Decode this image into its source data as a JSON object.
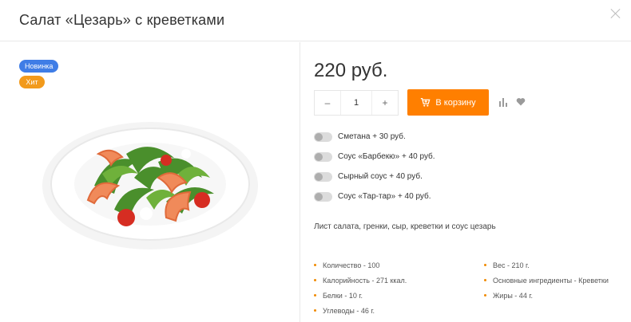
{
  "modal": {
    "title": "Салат «Цезарь» с креветками"
  },
  "badges": {
    "new": "Новинка",
    "hit": "Хит"
  },
  "product": {
    "price": "220 руб.",
    "quantity": "1",
    "add_to_cart": "В корзину",
    "description": "Лист салата, гренки, сыр, креветки и соус цезарь"
  },
  "addons": [
    {
      "label": "Сметана + 30 руб."
    },
    {
      "label": "Соус «Барбекю» + 40 руб."
    },
    {
      "label": "Сырный соус + 40 руб."
    },
    {
      "label": "Соус «Тар-тар» + 40 руб."
    }
  ],
  "properties": [
    "Количество - 100",
    "Вес - 210 г.",
    "Калорийность - 271 ккал.",
    "Основные ингредиенты - Креветки",
    "Белки - 10 г.",
    "Жиры - 44 г.",
    "Углеводы - 46 г."
  ],
  "colors": {
    "accent": "#ff7f00",
    "badge_new": "#3f7de6",
    "badge_hit": "#f29a1c"
  },
  "icons": {
    "close": "close-icon",
    "cart": "cart-icon",
    "compare": "compare-icon",
    "favorite": "heart-icon"
  }
}
